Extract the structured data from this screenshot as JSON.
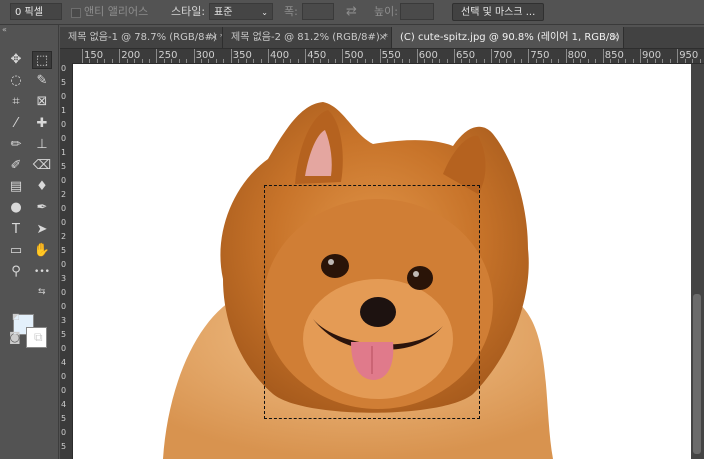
{
  "options": {
    "feather_value": "0 픽셀",
    "antialias_label": "앤티 앨리어스",
    "style_label": "스타일:",
    "style_value": "표준",
    "width_label": "폭:",
    "height_label": "높이:",
    "select_mask_label": "선택 및 마스크 ..."
  },
  "tabs": [
    {
      "label": "제목 없음-1 @ 78.7% (RGB/8#) *",
      "close": "×",
      "active": false
    },
    {
      "label": "제목 없음-2 @ 81.2% (RGB/8#) *",
      "close": "×",
      "active": false
    },
    {
      "label": "(C) cute-spitz.jpg @ 90.8% (레이어 1, RGB/8) *",
      "close": "×",
      "active": true
    }
  ],
  "ruler_h": [
    "150",
    "200",
    "250",
    "300",
    "350",
    "400",
    "450",
    "500",
    "550",
    "600",
    "650",
    "700",
    "750",
    "800",
    "850",
    "900",
    "950"
  ],
  "ruler_v": [
    "0",
    "5",
    "0",
    "1",
    "0",
    "0",
    "1",
    "5",
    "0",
    "2",
    "0",
    "0",
    "2",
    "5",
    "0",
    "3",
    "0",
    "0",
    "3",
    "5",
    "0",
    "4",
    "0",
    "0",
    "4",
    "5",
    "0",
    "5"
  ],
  "tools": [
    {
      "name": "move-tool-icon",
      "glyph": "✥"
    },
    {
      "name": "rect-marquee-tool-icon",
      "glyph": "⬚"
    },
    {
      "name": "lasso-tool-icon",
      "glyph": "◌"
    },
    {
      "name": "quick-select-tool-icon",
      "glyph": "✎"
    },
    {
      "name": "crop-tool-icon",
      "glyph": "⌗"
    },
    {
      "name": "frame-tool-icon",
      "glyph": "⊠"
    },
    {
      "name": "eyedropper-tool-icon",
      "glyph": "⁄"
    },
    {
      "name": "healing-brush-tool-icon",
      "glyph": "✚"
    },
    {
      "name": "brush-tool-icon",
      "glyph": "✏"
    },
    {
      "name": "clone-stamp-tool-icon",
      "glyph": "⊥"
    },
    {
      "name": "history-brush-tool-icon",
      "glyph": "✐"
    },
    {
      "name": "eraser-tool-icon",
      "glyph": "⌫"
    },
    {
      "name": "gradient-tool-icon",
      "glyph": "▤"
    },
    {
      "name": "blur-tool-icon",
      "glyph": "♦"
    },
    {
      "name": "dodge-tool-icon",
      "glyph": "●"
    },
    {
      "name": "pen-tool-icon",
      "glyph": "✒"
    },
    {
      "name": "type-tool-icon",
      "glyph": "T"
    },
    {
      "name": "path-select-tool-icon",
      "glyph": "➤"
    },
    {
      "name": "shape-tool-icon",
      "glyph": "▭"
    },
    {
      "name": "hand-tool-icon",
      "glyph": "✋"
    },
    {
      "name": "zoom-tool-icon",
      "glyph": "⚲"
    },
    {
      "name": "more-tools-icon",
      "glyph": "•••"
    }
  ],
  "colors": {
    "foreground": "#e3f0fb",
    "background": "#ffffff",
    "fur": "#c8742a"
  }
}
